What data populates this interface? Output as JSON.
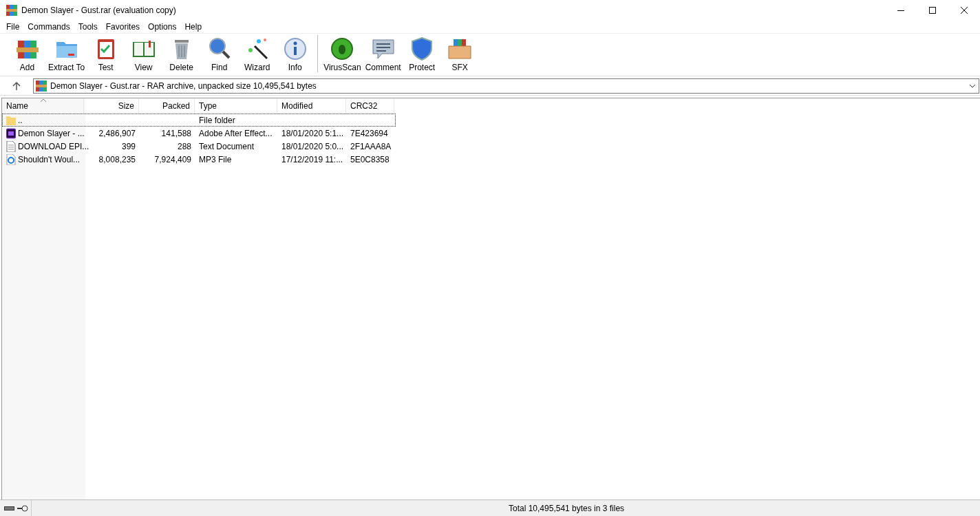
{
  "window": {
    "title": "Demon Slayer - Gust.rar (evaluation copy)"
  },
  "menu": [
    "File",
    "Commands",
    "Tools",
    "Favorites",
    "Options",
    "Help"
  ],
  "toolbar": [
    {
      "label": "Add",
      "kind": "add"
    },
    {
      "label": "Extract To",
      "kind": "extract"
    },
    {
      "label": "Test",
      "kind": "test"
    },
    {
      "label": "View",
      "kind": "view"
    },
    {
      "label": "Delete",
      "kind": "delete"
    },
    {
      "label": "Find",
      "kind": "find"
    },
    {
      "label": "Wizard",
      "kind": "wizard"
    },
    {
      "label": "Info",
      "kind": "info"
    },
    {
      "label": "VirusScan",
      "kind": "virus"
    },
    {
      "label": "Comment",
      "kind": "comment"
    },
    {
      "label": "Protect",
      "kind": "protect"
    },
    {
      "label": "SFX",
      "kind": "sfx"
    }
  ],
  "address": "Demon Slayer - Gust.rar - RAR archive, unpacked size 10,495,541 bytes",
  "table": {
    "columns": [
      "Name",
      "Size",
      "Packed",
      "Type",
      "Modified",
      "CRC32"
    ],
    "rows": [
      {
        "kind": "folder",
        "selected": true,
        "cells": [
          "..",
          "",
          "",
          "File folder",
          "",
          ""
        ]
      },
      {
        "kind": "ae",
        "selected": false,
        "cells": [
          "Demon Slayer - ...",
          "2,486,907",
          "141,588",
          "Adobe After Effect...",
          "18/01/2020 5:1...",
          "7E423694"
        ]
      },
      {
        "kind": "text",
        "selected": false,
        "cells": [
          "DOWNLOAD EPI...",
          "399",
          "288",
          "Text Document",
          "18/01/2020 5:0...",
          "2F1AAA8A"
        ]
      },
      {
        "kind": "mp3",
        "selected": false,
        "cells": [
          "Shouldn't Woul...",
          "8,008,235",
          "7,924,409",
          "MP3 File",
          "17/12/2019 11:...",
          "5E0C8358"
        ]
      }
    ]
  },
  "status_bar": "Total 10,495,541 bytes in 3 files"
}
